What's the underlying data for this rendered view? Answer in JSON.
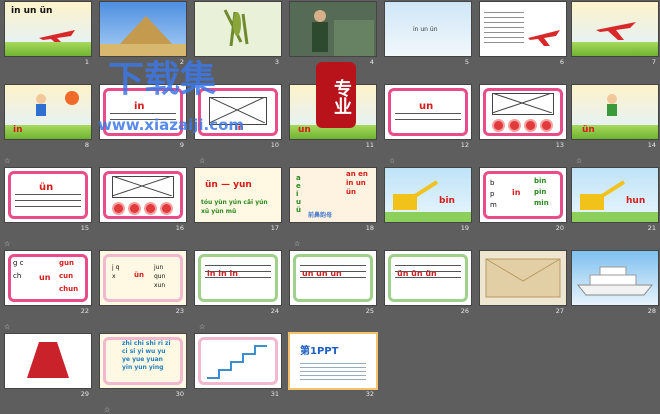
{
  "slides": [
    {
      "n": "1",
      "text": "in un ün"
    },
    {
      "n": "2"
    },
    {
      "n": "3"
    },
    {
      "n": "4"
    },
    {
      "n": "5",
      "text": "in un ün"
    },
    {
      "n": "6"
    },
    {
      "n": "7"
    },
    {
      "n": "8",
      "text": "in"
    },
    {
      "n": "9",
      "text": "in"
    },
    {
      "n": "10",
      "text": "in"
    },
    {
      "n": "11",
      "text": "un"
    },
    {
      "n": "12",
      "text": "un"
    },
    {
      "n": "13"
    },
    {
      "n": "14",
      "text": "ün"
    },
    {
      "n": "15",
      "text": "ün"
    },
    {
      "n": "16"
    },
    {
      "n": "17",
      "text": "ün — yun",
      "sub": "tóu yùn yún cǎi yún xū yùn mǔ"
    },
    {
      "n": "18",
      "left": "a e i u ü",
      "right": "an en in un ün",
      "caption": "前鼻韵母"
    },
    {
      "n": "19",
      "text": "bin"
    },
    {
      "n": "20",
      "left": "b p m",
      "mid": "in",
      "right": "bin pin min"
    },
    {
      "n": "21",
      "text": "hun"
    },
    {
      "n": "22",
      "left": "g c ch",
      "mid": "un",
      "right": "gun cun chun"
    },
    {
      "n": "23",
      "left": "j q x",
      "mid": "ün",
      "right": "jun qun xun"
    },
    {
      "n": "24",
      "text": "in in in"
    },
    {
      "n": "25",
      "text": "un un un"
    },
    {
      "n": "26",
      "text": "ün ün ün"
    },
    {
      "n": "27"
    },
    {
      "n": "28"
    },
    {
      "n": "29"
    },
    {
      "n": "30",
      "text": "zhi chi shi ri zi ci si yi wu yu ye yue yuan yin yun ying"
    },
    {
      "n": "31"
    },
    {
      "n": "32",
      "text": "第1PPT"
    }
  ],
  "watermark": {
    "main": "下载集",
    "sub": "www.xiazaiji.com",
    "badge": "专业"
  }
}
